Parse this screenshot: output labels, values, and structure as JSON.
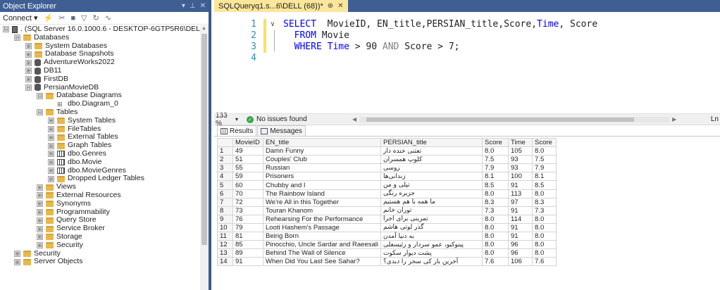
{
  "object_explorer": {
    "title": "Object Explorer",
    "title_controls": [
      "▾",
      "⊥",
      "✕"
    ],
    "toolbar": {
      "connect_label": "Connect ▾"
    },
    "tree": [
      {
        "depth": 0,
        "exp": "⊟",
        "icon": "server",
        "label": ". (SQL Server 16.0.1000.6 - DESKTOP-6GTP5R6\\DELL)"
      },
      {
        "depth": 1,
        "exp": "⊟",
        "icon": "folder",
        "label": "Databases"
      },
      {
        "depth": 2,
        "exp": "⊞",
        "icon": "folder",
        "label": "System Databases"
      },
      {
        "depth": 2,
        "exp": "⊞",
        "icon": "folder",
        "label": "Database Snapshots"
      },
      {
        "depth": 2,
        "exp": "⊞",
        "icon": "db",
        "label": "AdventureWorks2022"
      },
      {
        "depth": 2,
        "exp": "⊞",
        "icon": "db",
        "label": "DB11"
      },
      {
        "depth": 2,
        "exp": "⊞",
        "icon": "db",
        "label": "FirstDB"
      },
      {
        "depth": 2,
        "exp": "⊟",
        "icon": "db",
        "label": "PersianMovieDB"
      },
      {
        "depth": 3,
        "exp": "⊟",
        "icon": "folder",
        "label": "Database Diagrams"
      },
      {
        "depth": 4,
        "exp": "",
        "icon": "diagram",
        "label": "dbo.Diagram_0"
      },
      {
        "depth": 3,
        "exp": "⊟",
        "icon": "folder",
        "label": "Tables"
      },
      {
        "depth": 4,
        "exp": "⊞",
        "icon": "folder",
        "label": "System Tables"
      },
      {
        "depth": 4,
        "exp": "⊞",
        "icon": "folder",
        "label": "FileTables"
      },
      {
        "depth": 4,
        "exp": "⊞",
        "icon": "folder",
        "label": "External Tables"
      },
      {
        "depth": 4,
        "exp": "⊞",
        "icon": "folder",
        "label": "Graph Tables"
      },
      {
        "depth": 4,
        "exp": "⊞",
        "icon": "table",
        "label": "dbo.Genres"
      },
      {
        "depth": 4,
        "exp": "⊞",
        "icon": "table",
        "label": "dbo.Movie"
      },
      {
        "depth": 4,
        "exp": "⊞",
        "icon": "table",
        "label": "dbo.MovieGenres"
      },
      {
        "depth": 4,
        "exp": "⊞",
        "icon": "folder",
        "label": "Dropped Ledger Tables"
      },
      {
        "depth": 3,
        "exp": "⊞",
        "icon": "folder",
        "label": "Views"
      },
      {
        "depth": 3,
        "exp": "⊞",
        "icon": "folder",
        "label": "External Resources"
      },
      {
        "depth": 3,
        "exp": "⊞",
        "icon": "folder",
        "label": "Synonyms"
      },
      {
        "depth": 3,
        "exp": "⊞",
        "icon": "folder",
        "label": "Programmability"
      },
      {
        "depth": 3,
        "exp": "⊞",
        "icon": "folder",
        "label": "Query Store"
      },
      {
        "depth": 3,
        "exp": "⊞",
        "icon": "folder",
        "label": "Service Broker"
      },
      {
        "depth": 3,
        "exp": "⊞",
        "icon": "folder",
        "label": "Storage"
      },
      {
        "depth": 3,
        "exp": "⊞",
        "icon": "folder",
        "label": "Security"
      },
      {
        "depth": 1,
        "exp": "⊞",
        "icon": "folder",
        "label": "Security"
      },
      {
        "depth": 1,
        "exp": "⊞",
        "icon": "folder",
        "label": "Server Objects"
      }
    ]
  },
  "editor": {
    "tab_label": "SQLQueryq1.s...6\\DELL (68))*",
    "tab_pin": "⊕",
    "tab_close": "✕",
    "line_numbers": [
      "1",
      "2",
      "3",
      "4"
    ],
    "fold_marker": "∨",
    "code": {
      "l1_kw": "SELECT",
      "l1_a": "  MovieID, EN_title,PERSIAN_title,Score,",
      "l1_time": "Time",
      "l1_b": ", Score",
      "l2_kw": "FROM",
      "l2_a": " Movie",
      "l3_kw": "WHERE",
      "l3_time": "Time",
      "l3_a": " > 90 ",
      "l3_and": "AND",
      "l3_b": " Score > 7;"
    },
    "zoom": "133 %",
    "issues": "No issues found",
    "status_right": "Ln"
  },
  "results": {
    "tab_results": "Results",
    "tab_messages": "Messages",
    "columns": [
      "MovieID",
      "EN_title",
      "PERSIAN_title",
      "Score",
      "Time",
      "Score"
    ],
    "rows": [
      [
        "1",
        "49",
        "Damn Funny",
        "تعتنی خنده دار",
        "8.0",
        "105",
        "8.0"
      ],
      [
        "2",
        "51",
        "Couples' Club",
        "کلوپ همسران",
        "7.5",
        "93",
        "7.5"
      ],
      [
        "3",
        "55",
        "Russian",
        "روسی",
        "7.9",
        "93",
        "7.9"
      ],
      [
        "4",
        "59",
        "Prisoners",
        "زندانی‌ها",
        "8.1",
        "100",
        "8.1"
      ],
      [
        "5",
        "60",
        "Chubby and I",
        "تپلی و من",
        "8.5",
        "91",
        "8.5"
      ],
      [
        "6",
        "70",
        "The Rainbow Island",
        "جزیره رنگی",
        "8.0",
        "113",
        "8.0"
      ],
      [
        "7",
        "72",
        "We're All in this Together",
        "ما همه با هم هستیم",
        "8.3",
        "97",
        "8.3"
      ],
      [
        "8",
        "73",
        "Touran Khanom",
        "توران خانم",
        "7.3",
        "91",
        "7.3"
      ],
      [
        "9",
        "76",
        "Rehearsing For the Performance",
        "تمرینی برای اجرا",
        "8.0",
        "114",
        "8.0"
      ],
      [
        "10",
        "79",
        "Looti Hashem's Passage",
        "گذر لوتی هاشم",
        "8.0",
        "91",
        "8.0"
      ],
      [
        "11",
        "81",
        "Being Born",
        "به دنیا آمدن",
        "8.0",
        "91",
        "8.0"
      ],
      [
        "12",
        "85",
        "Pinocchio, Uncle Sardar and Raeesali",
        "پینوکیو، عمو سردار و رئیسعلی",
        "8.0",
        "96",
        "8.0"
      ],
      [
        "13",
        "89",
        "Behind The Wall of Silence",
        "پشت دیوار سکوت",
        "8.0",
        "96",
        "8.0"
      ],
      [
        "14",
        "91",
        "When Did You Last See Sahar?",
        "آخرین بار کی سحر را دیدی؟",
        "7.6",
        "106",
        "7.6"
      ]
    ]
  },
  "colors": {
    "title_bar": "#3f5f93",
    "active_tab": "#fbe69a",
    "keyword": "#0000ff",
    "line_number": "#2b91af"
  }
}
